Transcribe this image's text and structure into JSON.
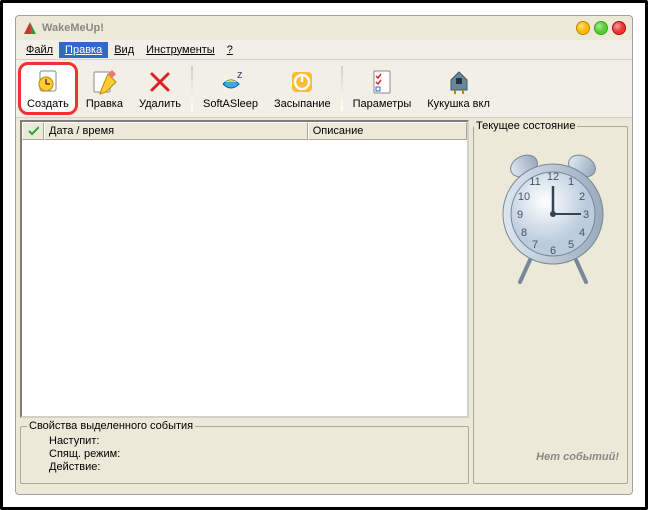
{
  "app": {
    "title": "WakeMeUp!"
  },
  "menu": {
    "items": [
      {
        "label": "Файл",
        "active": false
      },
      {
        "label": "Правка",
        "active": true
      },
      {
        "label": "Вид",
        "active": false
      },
      {
        "label": "Инструменты",
        "active": false
      },
      {
        "label": "?",
        "active": false
      }
    ]
  },
  "toolbar": {
    "create": "Создать",
    "edit": "Правка",
    "delete": "Удалить",
    "softasleep": "SoftASleep",
    "sleep": "Засыпание",
    "params": "Параметры",
    "cuckoo": "Кукушка вкл"
  },
  "list": {
    "col_datetime": "Дата / время",
    "col_desc": "Описание"
  },
  "props": {
    "title": "Свойства выделенного события",
    "occur": "Наступит:",
    "sleepmode": "Спящ. режим:",
    "action": "Действие:"
  },
  "state": {
    "title": "Текущее состояние",
    "noevents": "Нет событий!"
  }
}
